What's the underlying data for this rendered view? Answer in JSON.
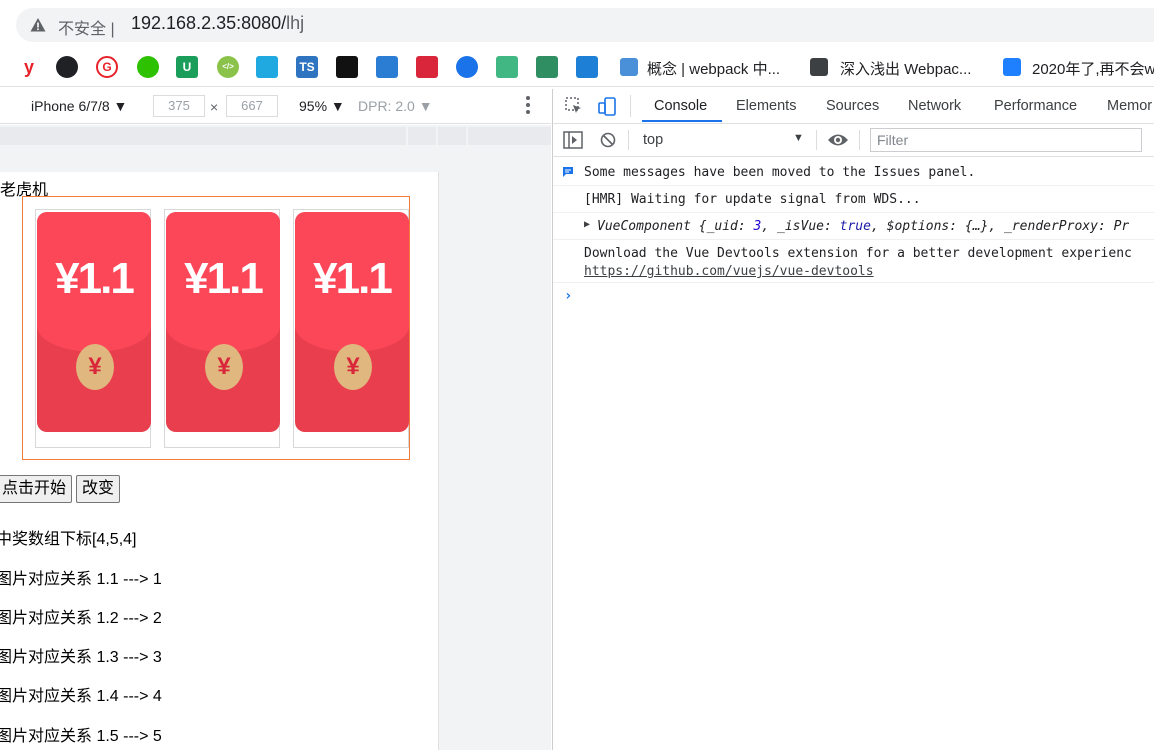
{
  "browser": {
    "security_label": "不安全 |",
    "url_host": "192.168.2.35:8080/",
    "url_path": "lhj",
    "bookmarks": [
      {
        "icon": "yonyou-icon",
        "glyph": "y",
        "color": "#e8222b"
      },
      {
        "icon": "github-icon",
        "glyph": "",
        "color": "#202124"
      },
      {
        "icon": "google-g-icon",
        "glyph": "G",
        "color": "#e8222b"
      },
      {
        "icon": "wechat-icon",
        "glyph": "",
        "color": "#2dc100"
      },
      {
        "icon": "u-icon",
        "glyph": "U",
        "color": "#1a9e5a"
      },
      {
        "icon": "code-icon",
        "glyph": "</>",
        "color": "#8bc34a"
      },
      {
        "icon": "hex-icon",
        "glyph": "",
        "color": "#1fa9e0"
      },
      {
        "icon": "typescript-icon",
        "glyph": "TS",
        "color": "#2f74c0"
      },
      {
        "icon": "dark-square-icon",
        "glyph": "",
        "color": "#111111"
      },
      {
        "icon": "mixed-icon",
        "glyph": "",
        "color": "#2b7cd3"
      },
      {
        "icon": "red-mascot-icon",
        "glyph": "",
        "color": "#d9263a"
      },
      {
        "icon": "blue-drop-icon",
        "glyph": "",
        "color": "#1a73e8"
      },
      {
        "icon": "vue-icon",
        "glyph": "",
        "color": "#41b883"
      },
      {
        "icon": "nuxt-icon",
        "glyph": "",
        "color": "#2f8f62"
      },
      {
        "icon": "blue-gem-icon",
        "glyph": "",
        "color": "#1e7fd6"
      }
    ],
    "bookmark_texts": [
      {
        "icon": "webpack-icon",
        "label": "概念 | webpack 中..."
      },
      {
        "icon": "book-icon",
        "label": "深入浅出 Webpac..."
      },
      {
        "icon": "juejin-icon",
        "label": "2020年了,再不会w"
      }
    ]
  },
  "device_toolbar": {
    "device": "iPhone 6/7/8 ▼",
    "width": "375",
    "height": "667",
    "times": "×",
    "zoom": "95% ▼",
    "dpr": "DPR: 2.0 ▼"
  },
  "page": {
    "title": "老虎机",
    "reels": [
      {
        "amount": "¥1.1",
        "coin": "¥"
      },
      {
        "amount": "¥1.1",
        "coin": "¥"
      },
      {
        "amount": "¥1.1",
        "coin": "¥"
      }
    ],
    "start_button": "点击开始",
    "change_button": "改变",
    "prize_indices": "中奖数组下标[4,5,4]",
    "mappings": [
      "图片对应关系 1.1 ---> 1",
      "图片对应关系 1.2 ---> 2",
      "图片对应关系 1.3 ---> 3",
      "图片对应关系 1.4 ---> 4",
      "图片对应关系 1.5 ---> 5"
    ]
  },
  "devtools": {
    "tabs": [
      "Console",
      "Elements",
      "Sources",
      "Network",
      "Performance",
      "Memor"
    ],
    "active_tab": "Console",
    "context": "top",
    "filter_placeholder": "Filter",
    "messages": {
      "issues": "Some messages have been moved to the Issues panel.",
      "hmr": "[HMR] Waiting for update signal from WDS...",
      "vue_prefix": "VueComponent {_uid: ",
      "vue_uid": "3",
      "vue_mid1": ", _isVue: ",
      "vue_true": "true",
      "vue_rest": ", $options: {…}, _renderProxy: Pr",
      "devtools_line": "Download the Vue Devtools extension for a better development experienc",
      "devtools_link": "https://github.com/vuejs/vue-devtools"
    },
    "prompt": "›"
  }
}
